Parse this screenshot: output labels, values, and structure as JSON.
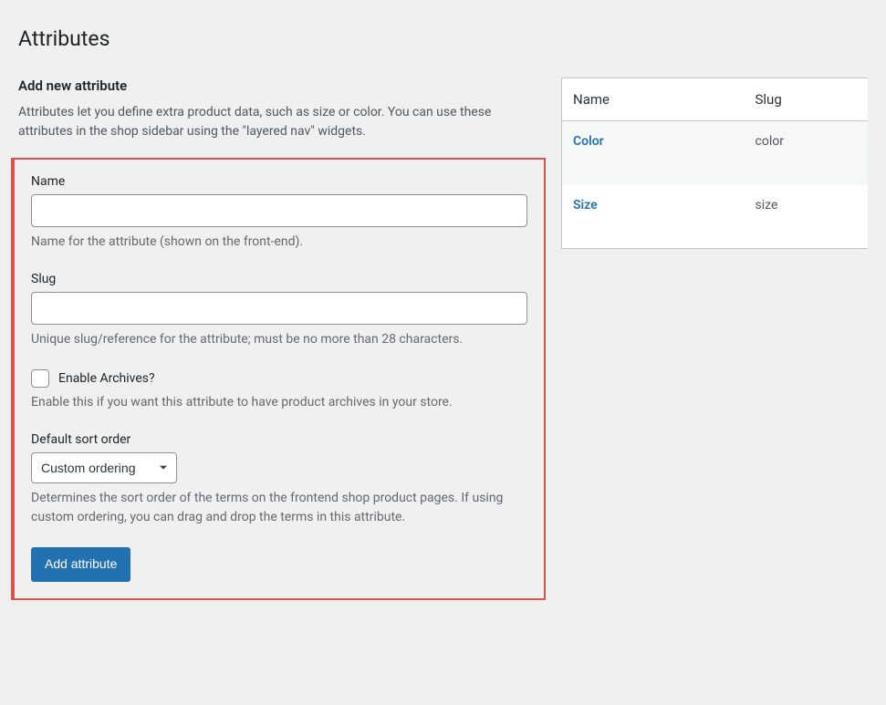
{
  "page_title": "Attributes",
  "form": {
    "heading": "Add new attribute",
    "intro": "Attributes let you define extra product data, such as size or color. You can use these attributes in the shop sidebar using the \"layered nav\" widgets.",
    "name": {
      "label": "Name",
      "value": "",
      "help": "Name for the attribute (shown on the front-end)."
    },
    "slug": {
      "label": "Slug",
      "value": "",
      "help": "Unique slug/reference for the attribute; must be no more than 28 characters."
    },
    "archives": {
      "label": "Enable Archives?",
      "checked": false,
      "help": "Enable this if you want this attribute to have product archives in your store."
    },
    "sort": {
      "label": "Default sort order",
      "selected": "Custom ordering",
      "help": "Determines the sort order of the terms on the frontend shop product pages. If using custom ordering, you can drag and drop the terms in this attribute."
    },
    "submit_label": "Add attribute"
  },
  "table": {
    "headers": {
      "name": "Name",
      "slug": "Slug"
    },
    "rows": [
      {
        "name": "Color",
        "slug": "color"
      },
      {
        "name": "Size",
        "slug": "size"
      }
    ]
  }
}
